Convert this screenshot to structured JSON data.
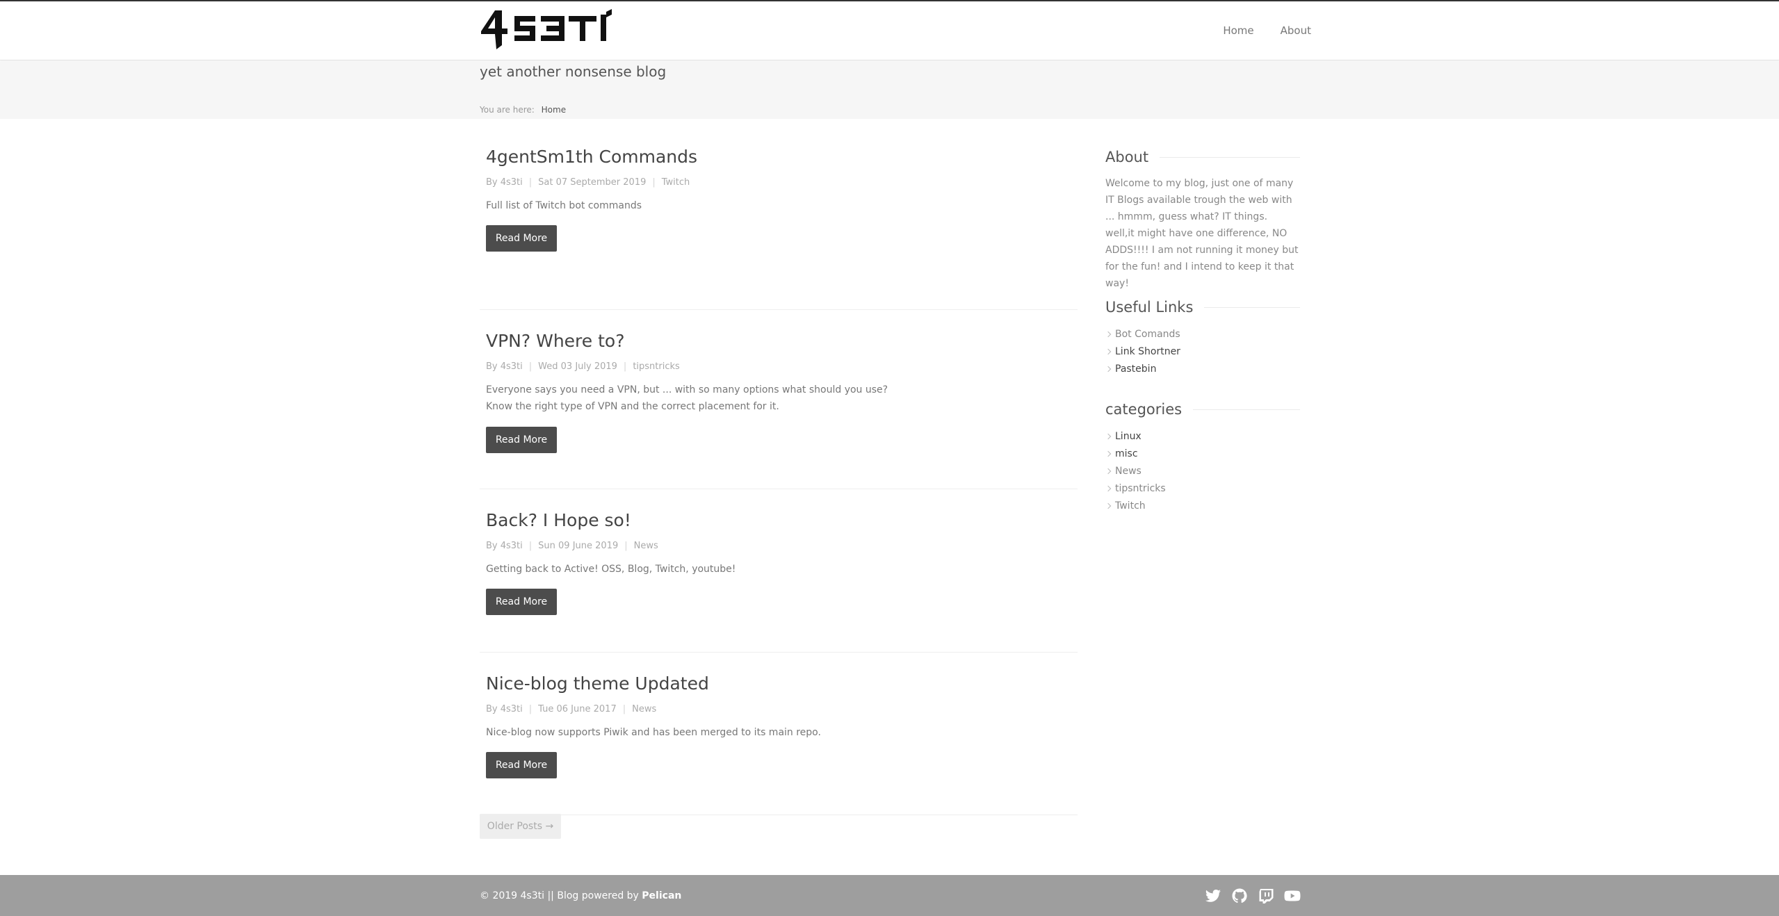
{
  "header": {
    "logo_text": "4s3ti",
    "nav": [
      {
        "label": "Home"
      },
      {
        "label": "About"
      }
    ]
  },
  "subheader": {
    "tagline": "yet another nonsense blog",
    "breadcrumb_prefix": "You are here:",
    "breadcrumb_current": "Home"
  },
  "posts": [
    {
      "title": "4gentSm1th Commands",
      "author": "By 4s3ti",
      "date": "Sat 07 September 2019",
      "category": "Twitch",
      "summary": "Full list of Twitch bot commands",
      "read_more": "Read More"
    },
    {
      "title": "VPN? Where to?",
      "author": "By 4s3ti",
      "date": "Wed 03 July 2019",
      "category": "tipsntricks",
      "summary_line1": "Everyone says you need a VPN, but ... with so many options what should you use?",
      "summary_line2": "Know the right type of VPN and the correct placement for it.",
      "read_more": "Read More"
    },
    {
      "title": "Back? I Hope so!",
      "author": "By 4s3ti",
      "date": "Sun 09 June 2019",
      "category": "News",
      "summary": "Getting back to Active! OSS, Blog, Twitch, youtube!",
      "read_more": "Read More"
    },
    {
      "title": "Nice-blog theme Updated",
      "author": "By 4s3ti",
      "date": "Tue 06 June 2017",
      "category": "News",
      "summary": "Nice-blog now supports Piwik and has been merged to its main repo.",
      "read_more": "Read More"
    }
  ],
  "pagination": {
    "older_label": "Older Posts →"
  },
  "sidebar": {
    "about_title": "About",
    "about_text": "Welcome to my blog, just one of many IT Blogs available trough the web with ... hmmm, guess what? IT things. well,it might have one difference, NO ADDS!!!! I am not running it money but for the fun! and I intend to keep it that way!",
    "links_title": "Useful Links",
    "links": [
      "Bot Comands",
      "Link Shortner",
      "Pastebin"
    ],
    "categories_title": "categories",
    "categories": [
      "Linux",
      "misc",
      "News",
      "tipsntricks",
      "Twitch"
    ]
  },
  "footer": {
    "copyright": "© 2019 4s3ti || Blog powered by",
    "powered_by": "Pelican",
    "social": [
      "twitter-icon",
      "github-icon",
      "twitch-icon",
      "youtube-icon"
    ]
  },
  "colors": {
    "footer_bg": "#9e9e9e",
    "button_bg": "#4c4c4c",
    "subheader_bg": "#f6f6f6"
  }
}
